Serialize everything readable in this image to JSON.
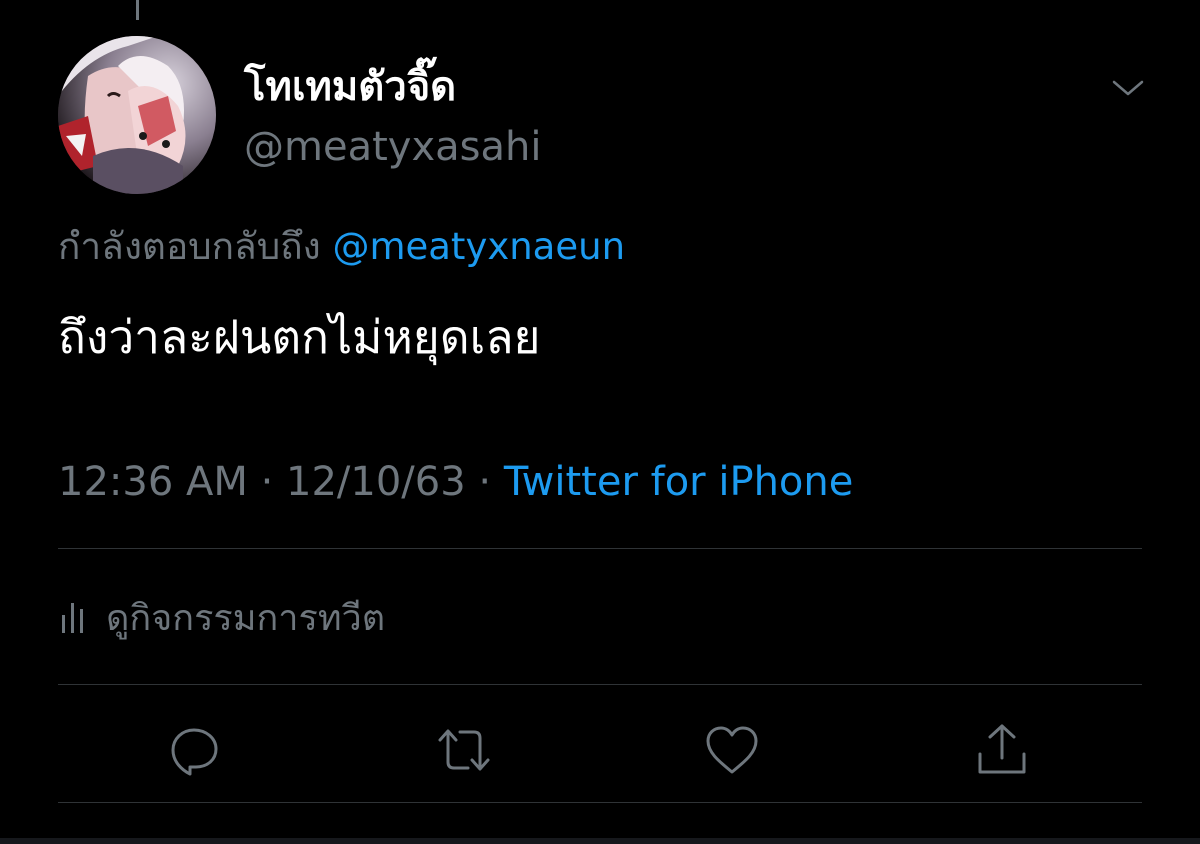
{
  "tweet": {
    "display_name": "โทเทมตัวจิ๊ด",
    "handle": "@meatyxasahi",
    "replying_to_prefix": "กำลังตอบกลับถึง",
    "replying_to_handle": "@meatyxnaeun",
    "text": "ถึงว่าละฝนตกไม่หยุดเลย",
    "time": "12:36 AM",
    "date": "12/10/63",
    "separator": "·",
    "source": "Twitter for iPhone",
    "activity_label": "ดูกิจกรรมการทวีต"
  },
  "actions": [
    {
      "name": "reply",
      "icon": "speech-bubble-icon"
    },
    {
      "name": "retweet",
      "icon": "retweet-icon"
    },
    {
      "name": "like",
      "icon": "heart-icon"
    },
    {
      "name": "share",
      "icon": "share-icon"
    }
  ],
  "colors": {
    "background": "#000000",
    "primary_text": "#ffffff",
    "secondary_text": "#6e767d",
    "accent": "#1d9bf0",
    "divider": "#2f3336"
  }
}
